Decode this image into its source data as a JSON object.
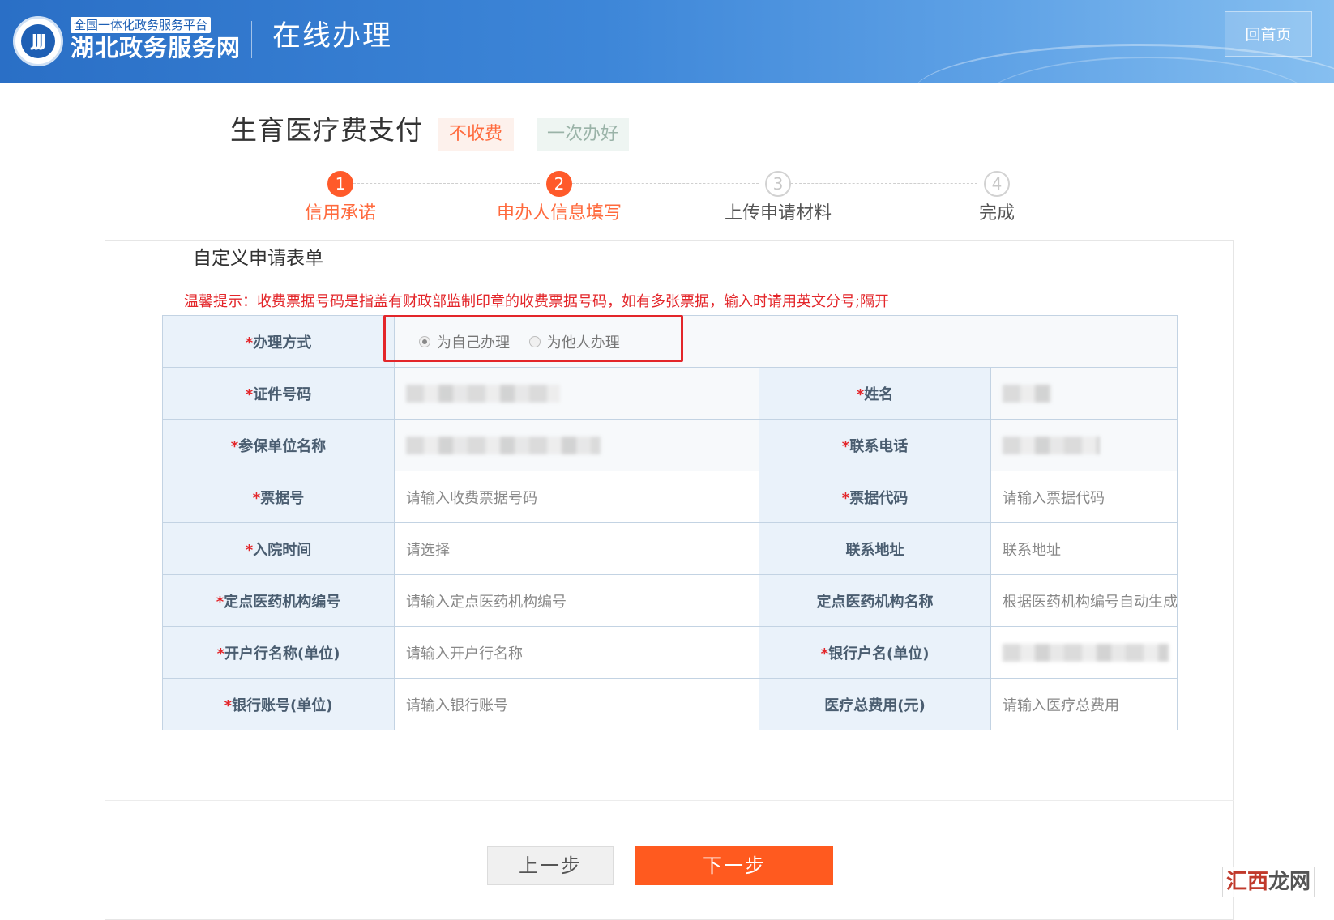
{
  "header": {
    "platform_tag": "全国一体化政务服务平台",
    "site_name": "湖北政务服务网",
    "section_title": "在线办理",
    "home_button": "回首页",
    "emblem_icon": "hubei-emblem-icon"
  },
  "service": {
    "title": "生育医疗费支付",
    "tag_fee": "不收费",
    "tag_once": "一次办好"
  },
  "steps": [
    {
      "num": "1",
      "label": "信用承诺",
      "state": "active"
    },
    {
      "num": "2",
      "label": "申办人信息填写",
      "state": "active"
    },
    {
      "num": "3",
      "label": "上传申请材料",
      "state": "pending"
    },
    {
      "num": "4",
      "label": "完成",
      "state": "pending"
    }
  ],
  "form": {
    "title": "自定义申请表单",
    "notice": "温馨提示：收费票据号码是指盖有财政部监制印章的收费票据号码，如有多张票据，输入时请用英文分号;隔开",
    "handling": {
      "label": "办理方式",
      "option_self": "为自己办理",
      "option_other": "为他人办理",
      "selected": "为自己办理"
    },
    "rows": [
      {
        "l1": "证件号码",
        "r1": true,
        "v1": "",
        "l2": "姓名",
        "r2": true,
        "v2": ""
      },
      {
        "l1": "参保单位名称",
        "r1": true,
        "v1": "",
        "l2": "联系电话",
        "r2": true,
        "v2": ""
      },
      {
        "l1": "票据号",
        "r1": true,
        "v1": "请输入收费票据号码",
        "l2": "票据代码",
        "r2": true,
        "v2": "请输入票据代码"
      },
      {
        "l1": "入院时间",
        "r1": true,
        "v1": "请选择",
        "l2": "联系地址",
        "r2": false,
        "v2": "联系地址"
      },
      {
        "l1": "定点医药机构编号",
        "r1": true,
        "v1": "请输入定点医药机构编号",
        "l2": "定点医药机构名称",
        "r2": false,
        "v2": "根据医药机构编号自动生成"
      },
      {
        "l1": "开户行名称(单位)",
        "r1": true,
        "v1": "请输入开户行名称",
        "l2": "银行户名(单位)",
        "r2": true,
        "v2": ""
      },
      {
        "l1": "银行账号(单位)",
        "r1": true,
        "v1": "请输入银行账号",
        "l2": "医疗总费用(元)",
        "r2": false,
        "v2": "请输入医疗总费用"
      }
    ],
    "required_mark": "*"
  },
  "buttons": {
    "prev": "上一步",
    "next": "下一步"
  },
  "watermark": {
    "part1": "汇西",
    "part2": "龙网"
  },
  "colors": {
    "accent": "#ff5a1f",
    "header_blue": "#2a6fc6",
    "required_red": "#e3262a"
  }
}
